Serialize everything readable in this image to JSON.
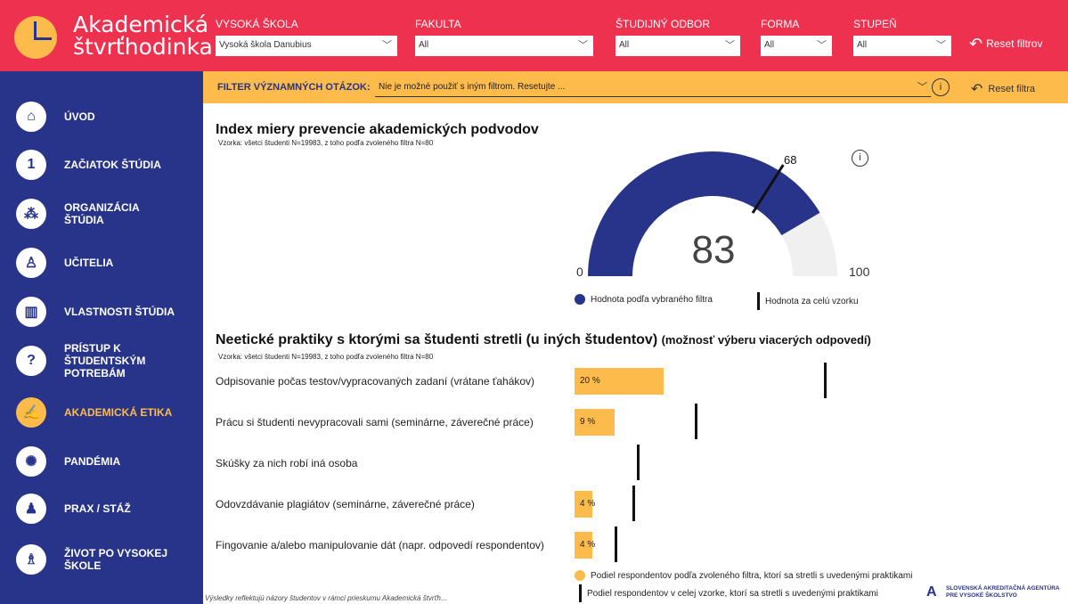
{
  "app": {
    "title_line1": "Akademická",
    "title_line2": "štvrťhodinka"
  },
  "filters": [
    {
      "label": "VYSOKÁ ŠKOLA",
      "value": "Vysoká škola Danubius"
    },
    {
      "label": "FAKULTA",
      "value": "All"
    },
    {
      "label": "ŠTUDIJNÝ ODBOR",
      "value": "All"
    },
    {
      "label": "FORMA",
      "value": "All"
    },
    {
      "label": "STUPEŇ",
      "value": "All"
    }
  ],
  "reset_filters_label": "Reset filtrov",
  "nav": [
    {
      "label": "ÚVOD",
      "icon": "home-icon"
    },
    {
      "label": "ZAČIATOK ŠTÚDIA",
      "icon": "number-one-icon"
    },
    {
      "label": "ORGANIZÁCIA ŠTÚDIA",
      "icon": "network-icon"
    },
    {
      "label": "UČITELIA",
      "icon": "teacher-icon"
    },
    {
      "label": "VLASTNOSTI ŠTÚDIA",
      "icon": "books-icon"
    },
    {
      "label": "PRÍSTUP K ŠTUDENTSKÝM POTREBÁM",
      "icon": "chat-person-icon"
    },
    {
      "label": "AKADEMICKÁ ETIKA",
      "icon": "ethics-icon",
      "active": true
    },
    {
      "label": "PANDÉMIA",
      "icon": "virus-icon"
    },
    {
      "label": "PRAX / STÁŽ",
      "icon": "worker-icon"
    },
    {
      "label": "ŽIVOT PO VYSOKEJ ŠKOLE",
      "icon": "graduate-icon"
    }
  ],
  "question_filter": {
    "label": "FILTER VÝZNAMNÝCH OTÁZOK:",
    "value": "Nie je možné použiť s iným filtrom. Resetujte ...",
    "info": "i",
    "reset_label": "Reset filtra"
  },
  "index_section": {
    "title": "Index miery prevencie akademických podvodov",
    "sample": "Vzorka: všetci študenti N=19983, z toho podľa zvoleného filtra N=80",
    "info": "i"
  },
  "chart_data": [
    {
      "type": "gauge",
      "value": 83,
      "min": 0,
      "max": 100,
      "target": 68,
      "value_color": "#28348a",
      "track_color": "#f0f0f0",
      "target_color": "#111111",
      "legend": [
        {
          "label": "Hodnota podľa vybraného filtra",
          "marker": "dot",
          "color": "#28348a"
        },
        {
          "label": "Hodnota za celú vzorku",
          "marker": "line",
          "color": "#111111"
        }
      ]
    },
    {
      "type": "bar",
      "orientation": "horizontal",
      "title": "Neetické praktiky s ktorými sa študenti stretli (u iných študentov)",
      "subtitle": "(možnosť výberu viacerých odpovedí)",
      "sample": "Vzorka: všetci študenti N=19983, z toho podľa zvoleného filtra N=80",
      "categories": [
        "Odpisovanie počas testov/vypracovaných zadaní (vrátane ťahákov)",
        "Prácu si študenti nevypracovali sami (seminárne, záverečné práce)",
        "Skúšky za nich robí iná osoba",
        "Odovzdávanie plagiátov (seminárne, záverečné práce)",
        "Fingovanie a/alebo manipulovanie dát (napr. odpovedí respondentov)"
      ],
      "series": [
        {
          "name": "Podiel respondentov podľa zvoleného filtra, ktorí sa stretli s uvedenými praktikami",
          "values": [
            20,
            9,
            0,
            4,
            4
          ],
          "labels": [
            "20 %",
            "9 %",
            "",
            "4 %",
            "4 %"
          ],
          "color": "#fcbb4a"
        },
        {
          "name": "Podiel respondentov v celej vzorke, ktorí sa stretli s uvedenými praktikami",
          "values": [
            56,
            27,
            14,
            13,
            9
          ],
          "marker": "line",
          "color": "#111111"
        }
      ],
      "xlim": [
        0,
        100
      ]
    }
  ],
  "footer": "Výsledky reflektujú názory študentov v rámci prieskumu Akademická štvrťh...",
  "agency": {
    "line1": "SLOVENSKÁ AKREDITAČNÁ AGENTÚRA",
    "line2": "PRE VYSOKÉ ŠKOLSTVO"
  }
}
